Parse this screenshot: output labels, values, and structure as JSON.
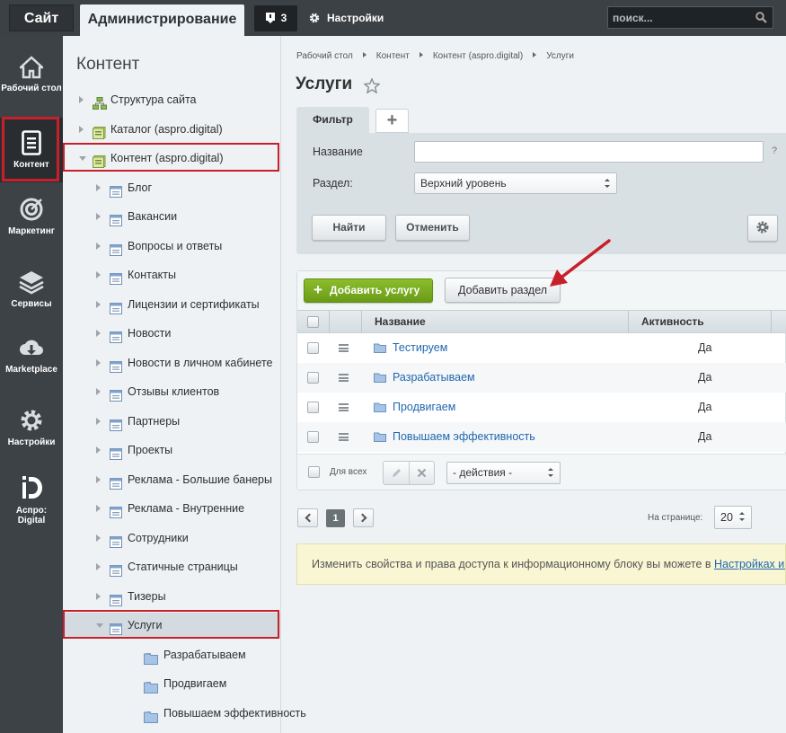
{
  "topbar": {
    "site_tab": "Сайт",
    "admin_tab": "Администрирование",
    "notifications_count": "3",
    "settings_label": "Настройки",
    "search_placeholder": "поиск..."
  },
  "leftmenu": [
    {
      "label": "Рабочий стол",
      "icon": "home-icon"
    },
    {
      "label": "Контент",
      "icon": "document-icon",
      "active": true
    },
    {
      "label": "Маркетинг",
      "icon": "target-icon"
    },
    {
      "label": "Сервисы",
      "icon": "layers-icon"
    },
    {
      "label": "Marketplace",
      "icon": "cloud-download-icon"
    },
    {
      "label": "Настройки",
      "icon": "gear-icon"
    },
    {
      "label": "Аспро: Digital",
      "icon": "aspro-logo-icon"
    }
  ],
  "tree": {
    "title": "Контент",
    "items": [
      {
        "label": "Структура сайта",
        "icon": "sitemap-icon",
        "state": "closed"
      },
      {
        "label": "Каталог (aspro.digital)",
        "icon": "catalog-icon",
        "state": "closed"
      },
      {
        "label": "Контент (aspro.digital)",
        "icon": "catalog-icon",
        "state": "open"
      },
      {
        "label": "Блог",
        "icon": "iblock-icon",
        "state": "closed"
      },
      {
        "label": "Вакансии",
        "icon": "iblock-icon",
        "state": "closed"
      },
      {
        "label": "Вопросы и ответы",
        "icon": "iblock-icon",
        "state": "closed"
      },
      {
        "label": "Контакты",
        "icon": "iblock-icon",
        "state": "closed"
      },
      {
        "label": "Лицензии и сертификаты",
        "icon": "iblock-icon",
        "state": "closed"
      },
      {
        "label": "Новости",
        "icon": "iblock-icon",
        "state": "closed"
      },
      {
        "label": "Новости в личном кабинете",
        "icon": "iblock-icon",
        "state": "closed"
      },
      {
        "label": "Отзывы клиентов",
        "icon": "iblock-icon",
        "state": "closed"
      },
      {
        "label": "Партнеры",
        "icon": "iblock-icon",
        "state": "closed"
      },
      {
        "label": "Проекты",
        "icon": "iblock-icon",
        "state": "closed"
      },
      {
        "label": "Реклама - Большие банеры",
        "icon": "iblock-icon",
        "state": "closed"
      },
      {
        "label": "Реклама - Внутренние",
        "icon": "iblock-icon",
        "state": "closed"
      },
      {
        "label": "Сотрудники",
        "icon": "iblock-icon",
        "state": "closed"
      },
      {
        "label": "Статичные страницы",
        "icon": "iblock-icon",
        "state": "closed"
      },
      {
        "label": "Тизеры",
        "icon": "iblock-icon",
        "state": "closed"
      },
      {
        "label": "Услуги",
        "icon": "iblock-icon",
        "state": "open",
        "selected": true
      },
      {
        "label": "Разрабатываем",
        "icon": "folder-icon",
        "state": "leaf"
      },
      {
        "label": "Продвигаем",
        "icon": "folder-icon",
        "state": "leaf"
      },
      {
        "label": "Повышаем эффективность",
        "icon": "folder-icon",
        "state": "leaf"
      }
    ]
  },
  "breadcrumb": [
    "Рабочий стол",
    "Контент",
    "Контент (aspro.digital)",
    "Услуги"
  ],
  "page_title": "Услуги",
  "filter": {
    "tab_label": "Фильтр",
    "add_tab": "+",
    "name_label": "Название",
    "name_value": "",
    "help": "?",
    "section_label": "Раздел:",
    "section_value": "Верхний уровень",
    "find_button": "Найти",
    "cancel_button": "Отменить"
  },
  "toolbar": {
    "add_service": "Добавить услугу",
    "add_section": "Добавить раздел"
  },
  "table": {
    "columns": [
      "Название",
      "Активность"
    ],
    "rows": [
      {
        "name": "Тестируем",
        "active": "Да"
      },
      {
        "name": "Разрабатываем",
        "active": "Да"
      },
      {
        "name": "Продвигаем",
        "active": "Да"
      },
      {
        "name": "Повышаем эффективность",
        "active": "Да"
      }
    ],
    "for_all": "Для всех",
    "actions_select": "- действия -"
  },
  "pagination": {
    "current_page": "1",
    "per_page_label": "На странице:",
    "per_page_value": "20"
  },
  "info": {
    "text": "Изменить свойства и права доступа к информационному блоку вы можете в ",
    "link": "Настройках информационного блока"
  },
  "colors": {
    "highlight_border": "#c8202a",
    "add_button": "#7aab20",
    "link": "#2067b0",
    "topbar": "#3c4145"
  }
}
